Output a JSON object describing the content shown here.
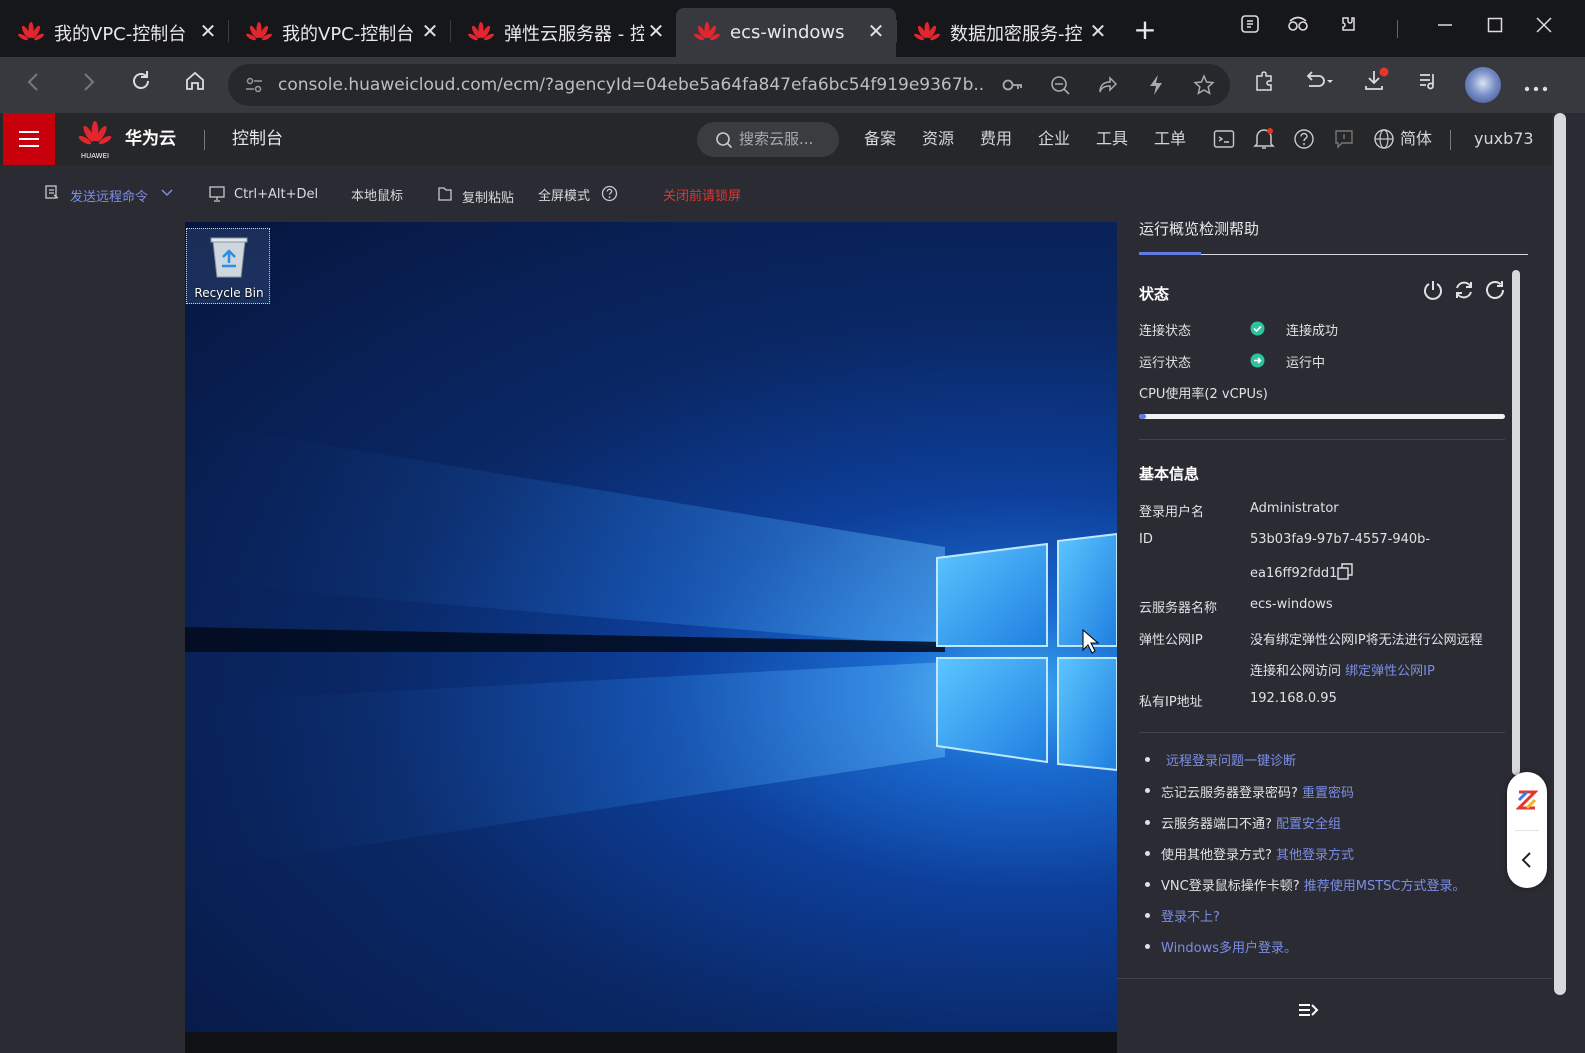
{
  "browser": {
    "tabs": [
      {
        "title": "我的VPC-控制台",
        "active": false
      },
      {
        "title": "我的VPC-控制台",
        "active": false
      },
      {
        "title": "弹性云服务器 - 控",
        "active": false
      },
      {
        "title": "ecs-windows",
        "active": true
      },
      {
        "title": "数据加密服务-控",
        "active": false
      }
    ],
    "close_glyph": "✕",
    "new_tab_glyph": "+",
    "url": "console.huaweicloud.com/ecm/?agencyId=04ebe5a64fa847efa6bc54f919e9367b..."
  },
  "header": {
    "brand_small": "HUAWEI",
    "brand": "华为云",
    "console": "控制台",
    "search_placeholder": "搜索云服...",
    "nav": [
      "备案",
      "资源",
      "费用",
      "企业",
      "工具",
      "工单"
    ],
    "language": "简体",
    "user": "yuxb73"
  },
  "vnc_toolbar": {
    "send_command": "发送远程命令",
    "ctrl_alt_del": "Ctrl+Alt+Del",
    "local_mouse": "本地鼠标",
    "copy_paste": "复制粘贴",
    "fullscreen": "全屏模式",
    "close_lock": "关闭前请锁屏"
  },
  "desktop": {
    "recycle_bin": "Recycle Bin"
  },
  "panel": {
    "tab_label": "运行概览检测帮助",
    "status_title": "状态",
    "connection_label": "连接状态",
    "connection_value": "连接成功",
    "run_label": "运行状态",
    "run_value": "运行中",
    "cpu_label": "CPU使用率(2 vCPUs)",
    "cpu_usage_fraction": 0.02,
    "basic_title": "基本信息",
    "fields": {
      "username_label": "登录用户名",
      "username": "Administrator",
      "id_label": "ID",
      "id_line1": "53b03fa9-97b7-4557-940b-",
      "id_line2": "ea16ff92fdd1",
      "name_label": "云服务器名称",
      "name": "ecs-windows",
      "eip_label": "弹性公网IP",
      "eip_line1": "没有绑定弹性公网IP将无法进行公网远程",
      "eip_line2": "连接和公网访问",
      "eip_link": "绑定弹性公网IP",
      "private_ip_label": "私有IP地址",
      "private_ip": "192.168.0.95"
    },
    "help": [
      {
        "text": "",
        "link": "远程登录问题一键诊断"
      },
      {
        "text": "忘记云服务器登录密码?",
        "link": "重置密码"
      },
      {
        "text": "云服务器端口不通?",
        "link": "配置安全组"
      },
      {
        "text": "使用其他登录方式?",
        "link": "其他登录方式"
      },
      {
        "text": "VNC登录鼠标操作卡顿?",
        "link": "推荐使用MSTSC方式登录。"
      },
      {
        "text": "",
        "link": "登录不上?"
      },
      {
        "text": "",
        "link": "Windows多用户登录。"
      }
    ]
  },
  "colors": {
    "brand_red": "#c7000b",
    "link": "#7b8ee6",
    "ok_green": "#2ec39c",
    "warn_red": "#e5342a"
  }
}
